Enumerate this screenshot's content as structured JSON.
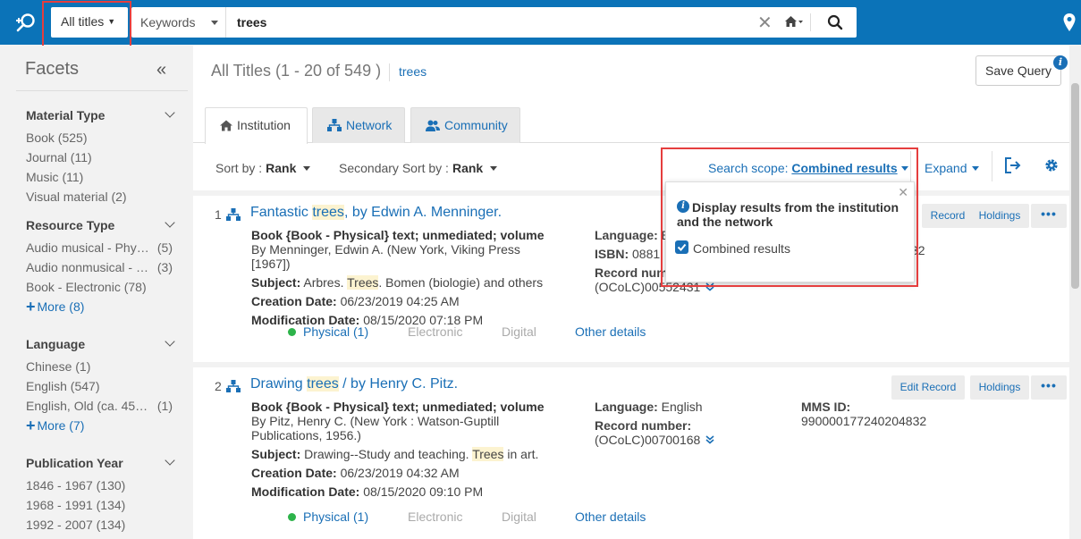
{
  "header": {
    "title_select": "All titles",
    "search_field": "Keywords",
    "search_value": "trees"
  },
  "facets": {
    "heading": "Facets",
    "groups": [
      {
        "title": "Material Type",
        "items": [
          {
            "label": "Book",
            "count": "(525)",
            "full": "Book (525)"
          },
          {
            "label": "Journal",
            "count": "(11)",
            "full": "Journal (11)"
          },
          {
            "label": "Music",
            "count": "(11)",
            "full": "Music (11)"
          },
          {
            "label": "Visual material",
            "count": "(2)",
            "full": "Visual material (2)"
          }
        ]
      },
      {
        "title": "Resource Type",
        "items": [
          {
            "label": "Audio musical - Phys...",
            "count": "(5)"
          },
          {
            "label": "Audio nonmusical - P...",
            "count": "(3)"
          },
          {
            "label": "Book - Electronic",
            "count": "(78)",
            "full": "Book - Electronic (78)"
          }
        ],
        "more": "More (8)"
      },
      {
        "title": "Language",
        "items": [
          {
            "label": "Chinese",
            "count": "(1)",
            "full": "Chinese (1)"
          },
          {
            "label": "English",
            "count": "(547)",
            "full": "English (547)"
          },
          {
            "label": "English, Old (ca. 450-...",
            "count": "(1)"
          }
        ],
        "more": "More (7)"
      },
      {
        "title": "Publication Year",
        "items": [
          {
            "full": "1846 - 1967 (130)"
          },
          {
            "full": "1968 - 1991 (134)"
          },
          {
            "full": "1992 - 2007 (134)"
          }
        ]
      }
    ]
  },
  "results": {
    "title": "All Titles (1 - 20 of 549 )",
    "query": "trees",
    "save_query": "Save Query",
    "tabs": [
      "Institution",
      "Network",
      "Community"
    ],
    "sort_label": "Sort by :",
    "sort_value": "Rank",
    "secondary_sort_label": "Secondary Sort by :",
    "secondary_sort_value": "Rank",
    "scope_label": "Search scope:",
    "scope_value": "Combined results",
    "expand": "Expand"
  },
  "popup": {
    "text": "Display results from the institution and the network",
    "checkbox_label": "Combined results",
    "checked": true
  },
  "records": [
    {
      "num": "1",
      "title_pre": "Fantastic ",
      "title_hl": "trees",
      "title_post": ", by Edwin A. Menninger.",
      "format": "Book {Book - Physical} text; unmediated; volume",
      "author": " By Menninger, Edwin A. (New York, Viking Press [1967])",
      "subject_label": "Subject:",
      "subject_pre": " Arbres. ",
      "subject_hl": "Trees",
      "subject_post": ". Bomen (biologie) and others",
      "creation_label": "Creation Date:",
      "creation": " 06/23/2019 04:25 AM",
      "modification_label": "Modification Date:",
      "modification": " 08/15/2020 07:18 PM",
      "language_label": "Language:",
      "language": " E",
      "isbn_label": "ISBN:",
      "isbn": " 0881",
      "record_label": "Record num",
      "record_value": "(OCoLC)00552431",
      "right_frag": "32",
      "physical": "Physical (1)",
      "electronic": "Electronic",
      "digital": "Digital",
      "other": "Other details",
      "edit": "Record",
      "holdings": "Holdings"
    },
    {
      "num": "2",
      "title_pre": "Drawing ",
      "title_hl": "trees",
      "title_post": " / by Henry C. Pitz.",
      "format": "Book {Book - Physical} text; unmediated; volume",
      "author": " By Pitz, Henry C. (New York : Watson-Guptill Publications, 1956.)",
      "subject_label": "Subject:",
      "subject_pre": " Drawing--Study and teaching. ",
      "subject_hl": "Trees",
      "subject_post": " in art.",
      "creation_label": "Creation Date:",
      "creation": " 06/23/2019 04:32 AM",
      "modification_label": "Modification Date:",
      "modification": " 08/15/2020 09:10 PM",
      "language_label": "Language:",
      "language": " English",
      "record_label": "Record number:",
      "record_value": "(OCoLC)00700168",
      "mms_label": "MMS ID:",
      "mms": "990000177240204832",
      "physical": "Physical (1)",
      "electronic": "Electronic",
      "digital": "Digital",
      "other": "Other details",
      "edit": "Edit Record",
      "holdings": "Holdings"
    }
  ],
  "colors": {
    "header_blue": "#0b73b8",
    "link_blue": "#1a6fb6",
    "highlight": "#fcf3d0",
    "red_outline": "#e53e3e",
    "available_green": "#2db34a"
  },
  "icons": [
    "logo-search-icon",
    "caret-down-icon",
    "close-icon",
    "home-icon",
    "search-icon",
    "location-pin-icon",
    "double-chevron-left-icon",
    "chevron-down-icon",
    "plus-icon",
    "network-icon",
    "community-icon",
    "export-icon",
    "gear-icon",
    "info-icon",
    "more-icon"
  ]
}
